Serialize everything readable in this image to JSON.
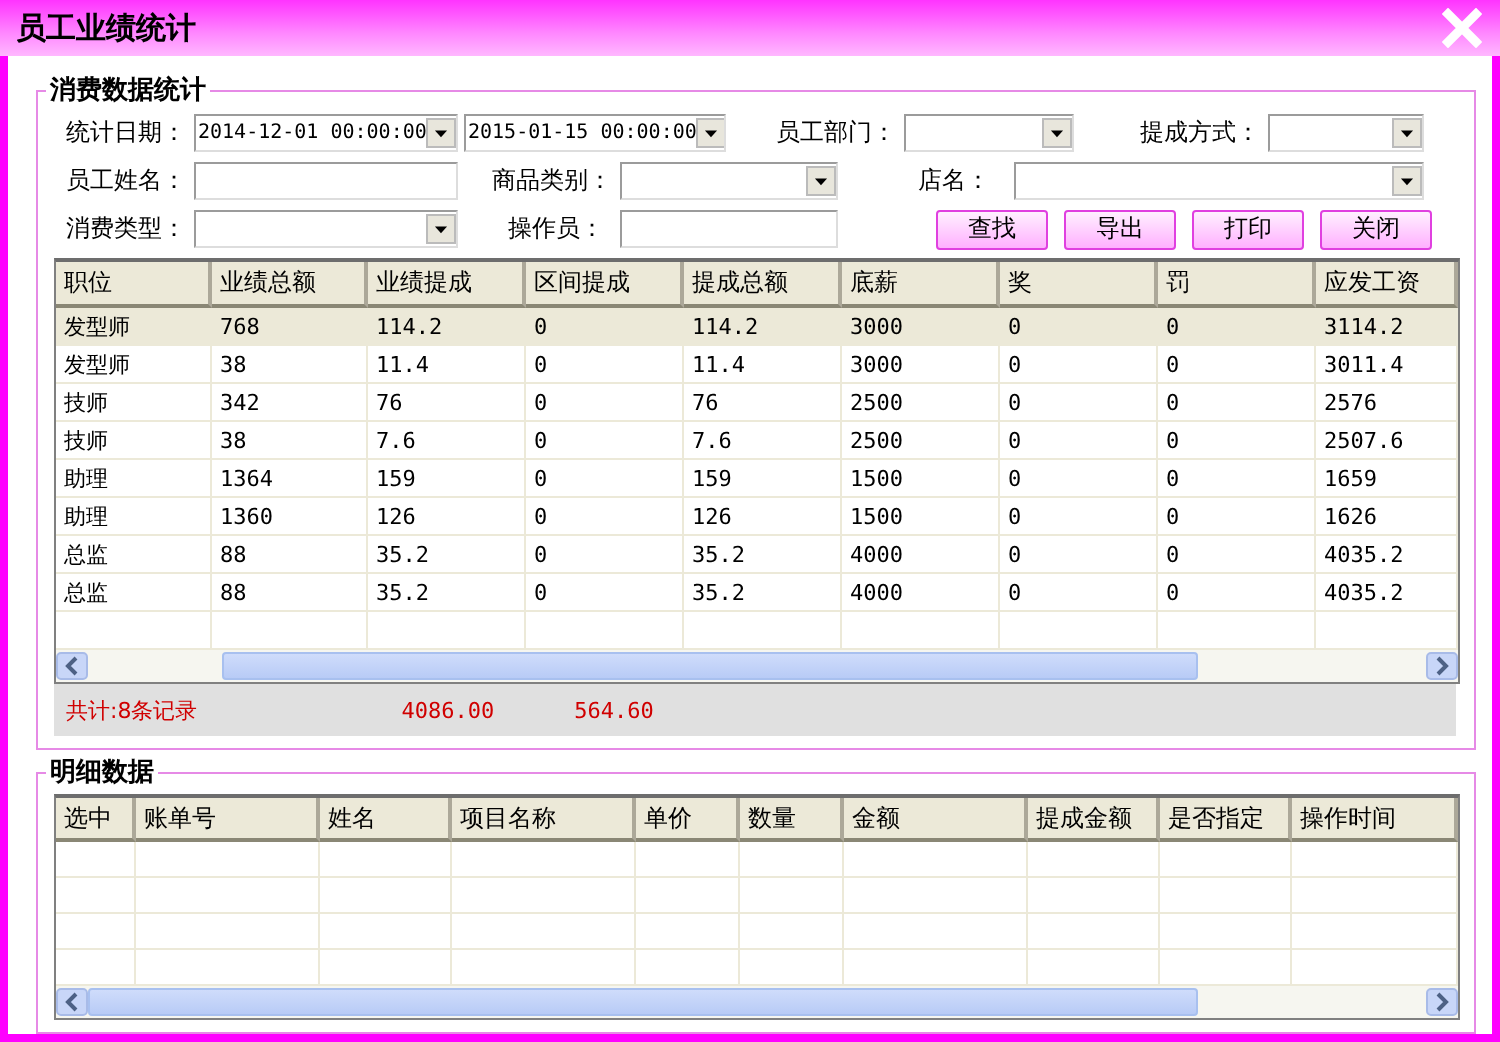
{
  "window": {
    "title": "员工业绩统计"
  },
  "summary_group": {
    "title": "消费数据统计",
    "filters": [
      {
        "kind": "label",
        "text": "统计日期："
      },
      {
        "kind": "combo",
        "value": "2014-12-01 00:00:00"
      },
      {
        "kind": "combo",
        "value": "2015-01-15 00:00:00"
      },
      {
        "kind": "label",
        "text": "员工部门："
      },
      {
        "kind": "combo"
      },
      {
        "kind": "label",
        "text": "提成方式："
      },
      {
        "kind": "combo"
      },
      {
        "kind": "label",
        "text": "员工姓名："
      },
      {
        "kind": "input"
      },
      {
        "kind": "label",
        "text": "商品类别："
      },
      {
        "kind": "combo"
      },
      {
        "kind": "label",
        "text": "店名："
      },
      {
        "kind": "combo"
      },
      {
        "kind": "label",
        "text": "消费类型："
      },
      {
        "kind": "combo"
      },
      {
        "kind": "label",
        "text": "操作员："
      },
      {
        "kind": "input"
      }
    ],
    "buttons": [
      "查找",
      "导出",
      "打印",
      "关闭"
    ],
    "table": {
      "columns": [
        "职位",
        "业绩总额",
        "业绩提成",
        "区间提成",
        "提成总额",
        "底薪",
        "奖",
        "罚",
        "应发工资"
      ],
      "rows": [
        {
          "selected": true,
          "cells": [
            "发型师",
            "768",
            "114.2",
            "0",
            "114.2",
            "3000",
            "0",
            "0",
            "3114.2"
          ]
        },
        {
          "selected": false,
          "cells": [
            "发型师",
            "38",
            "11.4",
            "0",
            "11.4",
            "3000",
            "0",
            "0",
            "3011.4"
          ]
        },
        {
          "selected": false,
          "cells": [
            "技师",
            "342",
            "76",
            "0",
            "76",
            "2500",
            "0",
            "0",
            "2576"
          ]
        },
        {
          "selected": false,
          "cells": [
            "技师",
            "38",
            "7.6",
            "0",
            "7.6",
            "2500",
            "0",
            "0",
            "2507.6"
          ]
        },
        {
          "selected": false,
          "cells": [
            "助理",
            "1364",
            "159",
            "0",
            "159",
            "1500",
            "0",
            "0",
            "1659"
          ]
        },
        {
          "selected": false,
          "cells": [
            "助理",
            "1360",
            "126",
            "0",
            "126",
            "1500",
            "0",
            "0",
            "1626"
          ]
        },
        {
          "selected": false,
          "cells": [
            "总监",
            "88",
            "35.2",
            "0",
            "35.2",
            "4000",
            "0",
            "0",
            "4035.2"
          ]
        },
        {
          "selected": false,
          "cells": [
            "总监",
            "88",
            "35.2",
            "0",
            "35.2",
            "4000",
            "0",
            "0",
            "4035.2"
          ]
        }
      ]
    },
    "totals": {
      "count": "共计:8条记录",
      "total_amount": "4086.00",
      "total_commission": "564.60"
    }
  },
  "detail_group": {
    "title": "明细数据",
    "table": {
      "columns": [
        "选中",
        "账单号",
        "姓名",
        "项目名称",
        "单价",
        "数量",
        "金额",
        "提成金额",
        "是否指定",
        "操作时间"
      ]
    }
  }
}
